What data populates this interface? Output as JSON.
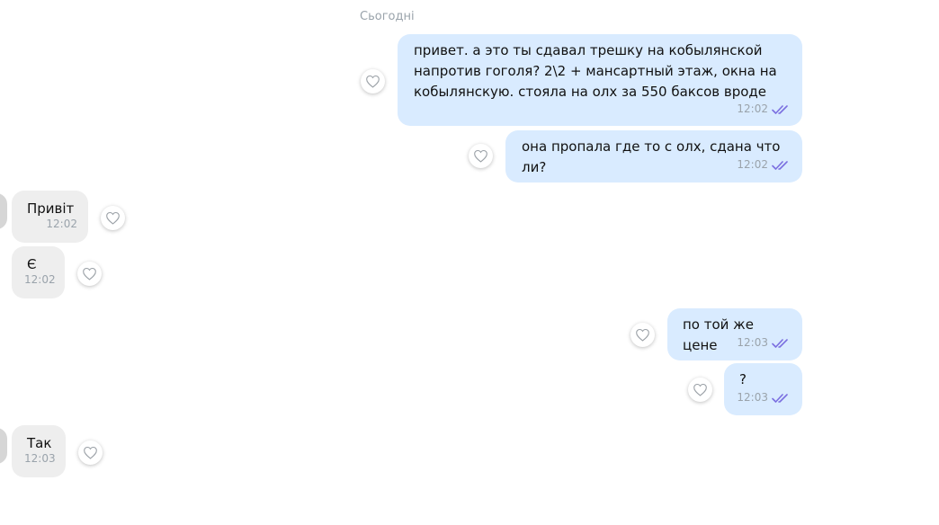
{
  "date_separator": "Сьогодні",
  "messages": [
    {
      "direction": "out",
      "text": "привет. а это ты сдавал трешку на кобылянской\nнапротив гоголя? 2\\2 + мансартный этаж, окна на\nкобылянскую. стояла на олх за 550 баксов вроде",
      "time": "12:02",
      "read": true
    },
    {
      "direction": "out",
      "text": "она пропала где то с олх, сдана что ли?",
      "time": "12:02",
      "read": true
    },
    {
      "direction": "in",
      "text": "Привіт",
      "time": "12:02"
    },
    {
      "direction": "in",
      "text": "Є",
      "time": "12:02"
    },
    {
      "direction": "out",
      "text": "по той же цене",
      "time": "12:03",
      "read": true
    },
    {
      "direction": "out",
      "text": "?",
      "time": "12:03",
      "read": true
    },
    {
      "direction": "in",
      "text": "Так",
      "time": "12:03"
    }
  ],
  "colors": {
    "outgoing_bubble": "#d9ebff",
    "incoming_bubble": "#eeeeee",
    "read_ticks": "#7b6fe0",
    "meta_text": "#9aa3ab"
  },
  "icons": {
    "like": "heart-outline-icon",
    "read": "double-check-icon"
  }
}
